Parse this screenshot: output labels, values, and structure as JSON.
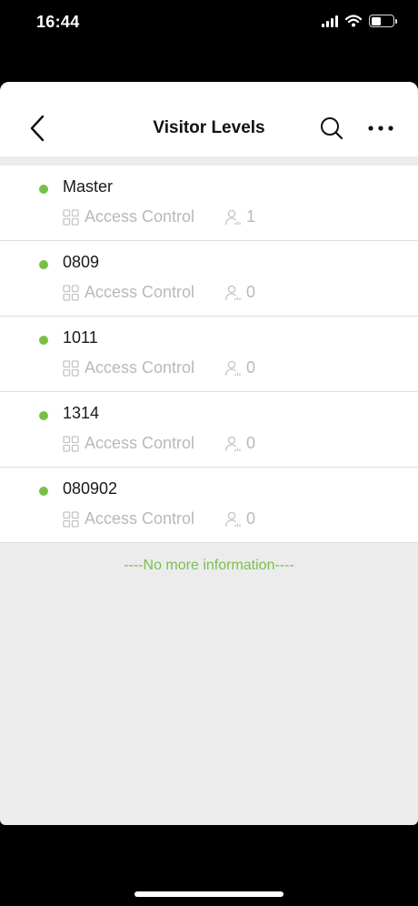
{
  "status_bar": {
    "time": "16:44",
    "icons": [
      "signal-icon",
      "wifi-icon",
      "battery-icon"
    ],
    "battery_level": 0.45
  },
  "nav": {
    "title": "Visitor Levels",
    "back_icon": "chevron-left-icon",
    "search_icon": "search-icon",
    "more_icon": "more-icon"
  },
  "levels": [
    {
      "name": "Master",
      "type": "Access Control",
      "count": "1"
    },
    {
      "name": "0809",
      "type": "Access Control",
      "count": "0"
    },
    {
      "name": "1011",
      "type": "Access Control",
      "count": "0"
    },
    {
      "name": "1314",
      "type": "Access Control",
      "count": "0"
    },
    {
      "name": "080902",
      "type": "Access Control",
      "count": "0"
    }
  ],
  "footer": {
    "no_more_text": "----No more information----"
  },
  "colors": {
    "accent": "#78c045",
    "secondary_text": "#b9b9b9"
  }
}
